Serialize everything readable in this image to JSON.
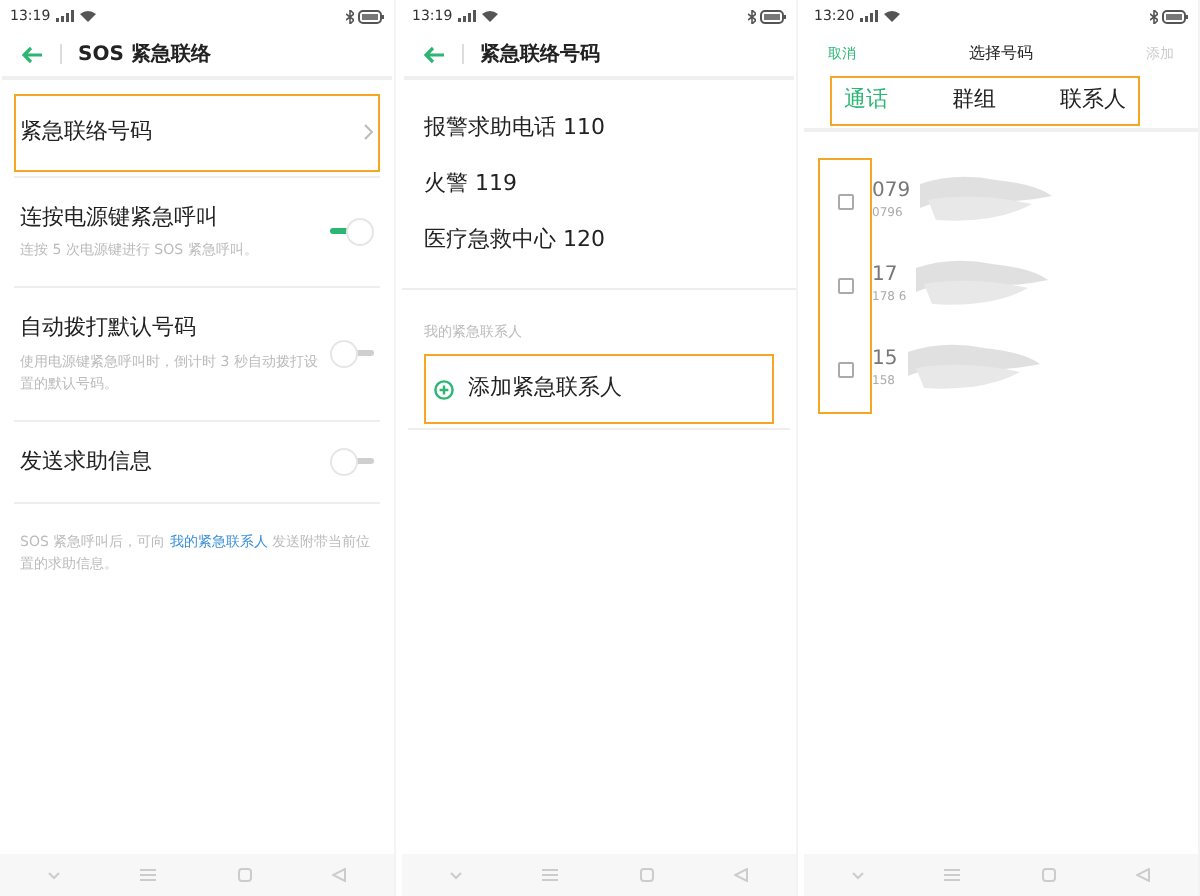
{
  "screens": [
    {
      "status_bar": {
        "time": "13:19"
      },
      "header": {
        "title": "SOS 紧急联络"
      },
      "settings": [
        {
          "kind": "link",
          "label": "紧急联络号码",
          "highlighted": true
        },
        {
          "kind": "toggle",
          "label": "连按电源键紧急呼叫",
          "description": "连按 5 次电源键进行 SOS 紧急呼叫。",
          "on": true,
          "highlighted": false
        },
        {
          "kind": "toggle",
          "label": "自动拨打默认号码",
          "description": "使用电源键紧急呼叫时，倒计时 3 秒自动拨打设置的默认号码。",
          "on": false,
          "highlighted": false
        },
        {
          "kind": "toggle",
          "label": "发送求助信息",
          "on": false,
          "highlighted": false
        }
      ],
      "footer_note": {
        "before": "SOS 紧急呼叫后，可向 ",
        "link": "我的紧急联系人",
        "after": " 发送附带当前位置的求助信息。"
      }
    },
    {
      "status_bar": {
        "time": "13:19"
      },
      "header": {
        "title": "紧急联络号码"
      },
      "numbers": [
        "报警求助电话 110",
        "火警 119",
        "医疗急救中心 120"
      ],
      "section_label": "我的紧急联系人",
      "add_button": {
        "label": "添加紧急联系人",
        "highlighted": true
      }
    },
    {
      "status_bar": {
        "time": "13:20"
      },
      "header": {
        "cancel": "取消",
        "title": "选择号码",
        "confirm": "添加",
        "confirm_disabled": true
      },
      "tabs_highlighted": true,
      "tabs": [
        {
          "label": "通话",
          "selected": true
        },
        {
          "label": "群组",
          "selected": false
        },
        {
          "label": "联系人",
          "selected": false
        }
      ],
      "checkboxes_highlighted": true,
      "contacts": [
        {
          "name": "079",
          "number": "0796",
          "checked": false
        },
        {
          "name": "17",
          "number": "178 6",
          "checked": false
        },
        {
          "name": "15",
          "number": "158",
          "checked": false
        }
      ]
    }
  ]
}
